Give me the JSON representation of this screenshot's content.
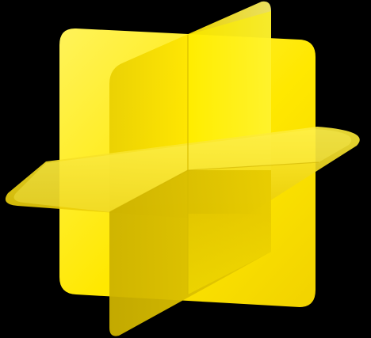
{
  "artwork": {
    "name": "three-intersecting-planes-icon",
    "colors": {
      "background": "#000000",
      "yellow_bright": "#FFF000",
      "yellow_mid": "#F4DC00",
      "yellow_deep": "#E2C400",
      "yellow_shadow": "#B89E00",
      "highlight": "#FFFFA0"
    }
  }
}
